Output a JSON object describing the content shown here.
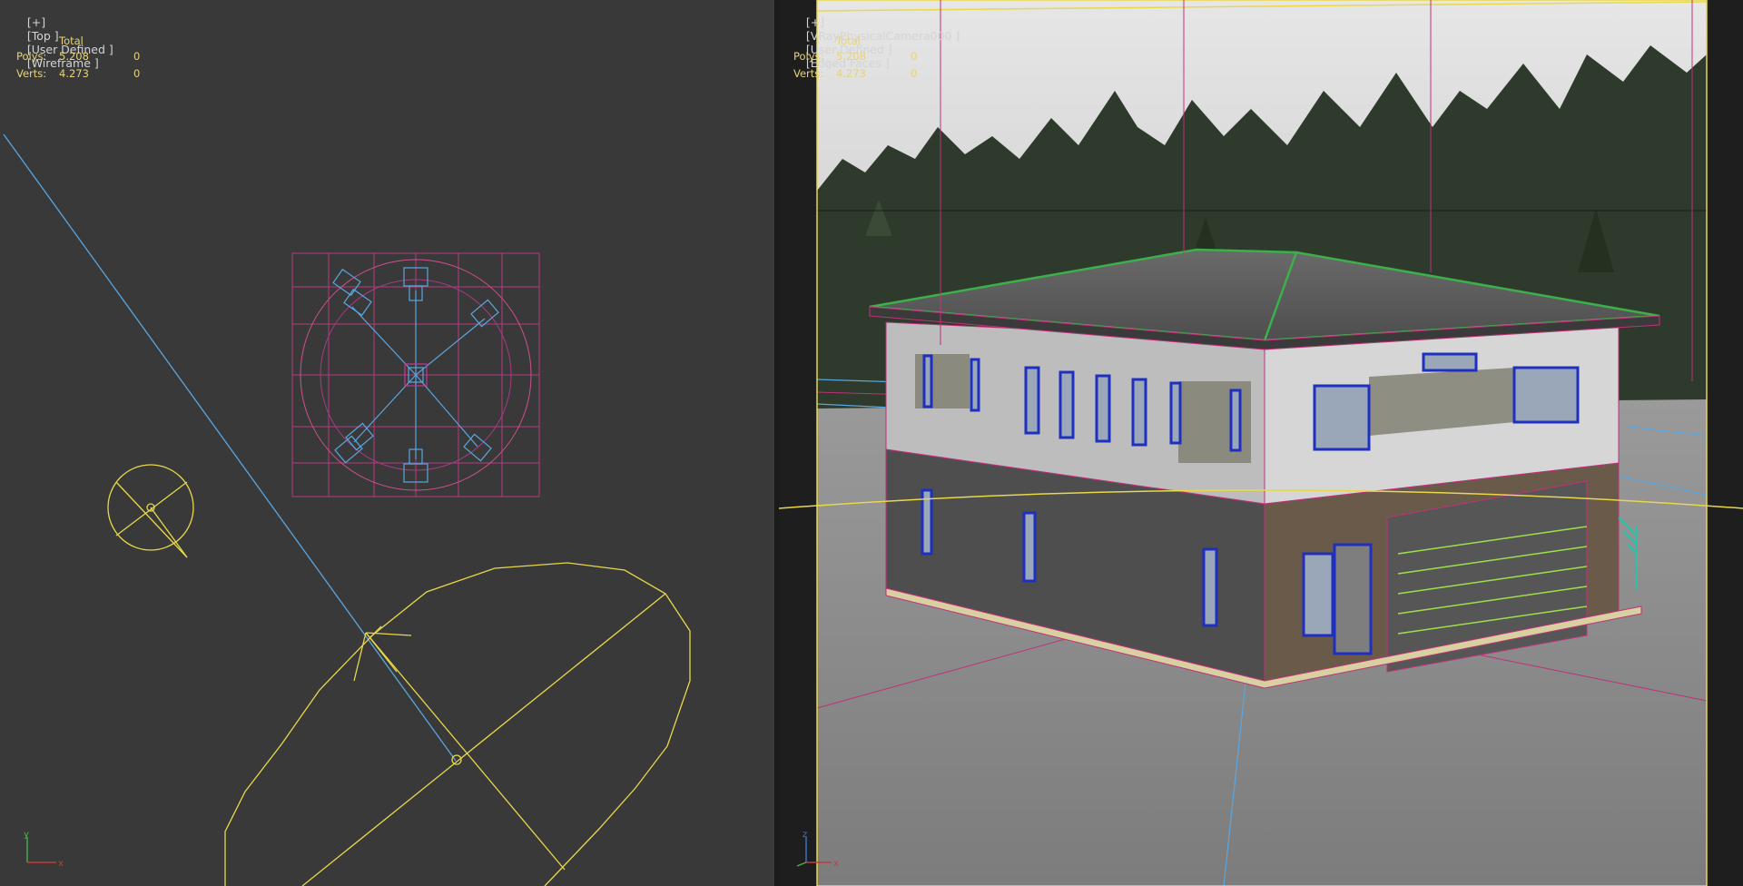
{
  "viewports": {
    "left": {
      "label": "[+] [Top ] [User Defined ] [Wireframe ]",
      "label_parts": [
        "[+]",
        "[Top ]",
        "[User Defined ]",
        "[Wireframe ]"
      ],
      "stats": {
        "header": "Total",
        "rows": [
          {
            "key": "Polys:",
            "total": "5.208",
            "selected": "0"
          },
          {
            "key": "Verts:",
            "total": "4.273",
            "selected": "0"
          }
        ]
      },
      "axis": {
        "x": "x",
        "y": "y"
      }
    },
    "right": {
      "label": "[+] [VRayPhysicalCamera000 ] [User Defined ] [Edged Faces ]",
      "label_parts": [
        "[+]",
        "[VRayPhysicalCamera000 ]",
        "[User Defined ]",
        "[Edged Faces ]"
      ],
      "stats": {
        "header": "Total",
        "rows": [
          {
            "key": "Polys:",
            "total": "5.208",
            "selected": "0"
          },
          {
            "key": "Verts:",
            "total": "4.273",
            "selected": "0"
          }
        ]
      },
      "axis": {
        "x": "x",
        "z": "z"
      }
    }
  },
  "colors": {
    "viewport_bg": "#393939",
    "stats_text": "#e6d37a",
    "light_yellow": "#e8d84a",
    "camera_blue": "#5aa6e0",
    "object_magenta": "#c0307a",
    "roof_green": "#3cb04a"
  }
}
